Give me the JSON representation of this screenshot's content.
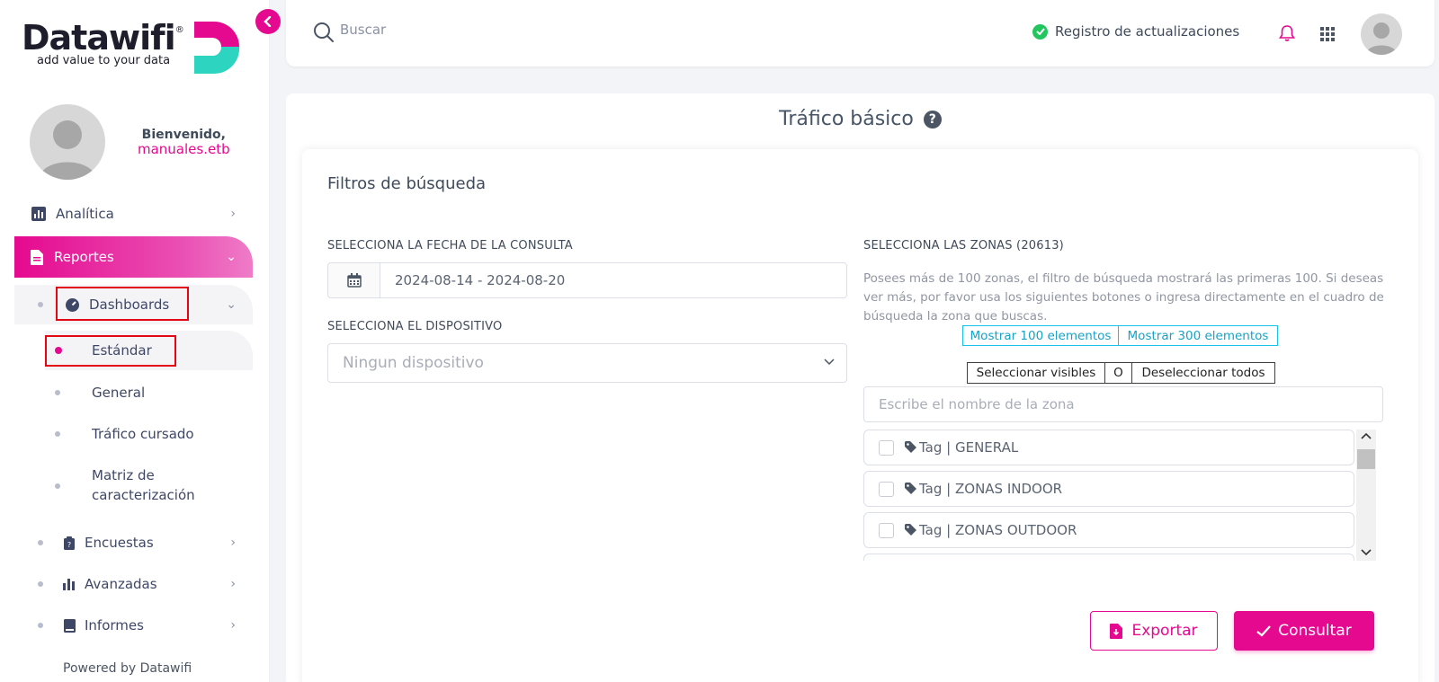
{
  "brand": {
    "name": "Datawifi",
    "registered": "®",
    "tagline": "add value to your data",
    "colors": {
      "primary": "#e5098f",
      "teal": "#2dd4bf",
      "dark": "#1d1d2b"
    }
  },
  "user": {
    "welcome": "Bienvenido,",
    "username": "manuales.etb"
  },
  "sidebar": {
    "items": [
      {
        "label": "Analítica",
        "icon": "chart-icon"
      },
      {
        "label": "Reportes",
        "icon": "document-icon"
      },
      {
        "label": "Dashboards",
        "icon": "gauge-icon"
      },
      {
        "label": "Estándar"
      },
      {
        "label": "General"
      },
      {
        "label": "Tráfico cursado"
      },
      {
        "label": "Matriz de caracterización"
      },
      {
        "label": "Encuestas",
        "icon": "clipboard-icon"
      },
      {
        "label": "Avanzadas",
        "icon": "bar-chart-icon"
      },
      {
        "label": "Informes",
        "icon": "book-icon"
      }
    ],
    "footer": "Powered by Datawifi"
  },
  "topbar": {
    "search_placeholder": "Buscar",
    "updates_label": "Registro de actualizaciones"
  },
  "main": {
    "title": "Tráfico básico",
    "filters_title": "Filtros de búsqueda",
    "date_label": "SELECCIONA LA FECHA DE LA CONSULTA",
    "date_value": "2024-08-14 - 2024-08-20",
    "device_label": "SELECCIONA EL DISPOSITIVO",
    "device_placeholder": "Ningun dispositivo",
    "zones_label": "SELECCIONA LAS ZONAS (20613)",
    "zones_description": "Posees más de 100 zonas, el filtro de búsqueda mostrará las primeras 100. Si deseas ver más, por favor usa los siguientes botones o ingresa directamente en el cuadro de búsqueda la zona que buscas.",
    "show_100": "Mostrar 100 elementos",
    "show_300": "Mostrar 300 elementos",
    "select_visible": "Seleccionar visibles",
    "or": "O",
    "deselect_all": "Deseleccionar todos",
    "zone_search_placeholder": "Escribe el nombre de la zona",
    "zones": [
      {
        "label": "Tag | GENERAL"
      },
      {
        "label": "Tag | ZONAS INDOOR"
      },
      {
        "label": "Tag | ZONAS OUTDOOR"
      }
    ],
    "export_label": "Exportar",
    "consult_label": "Consultar"
  }
}
